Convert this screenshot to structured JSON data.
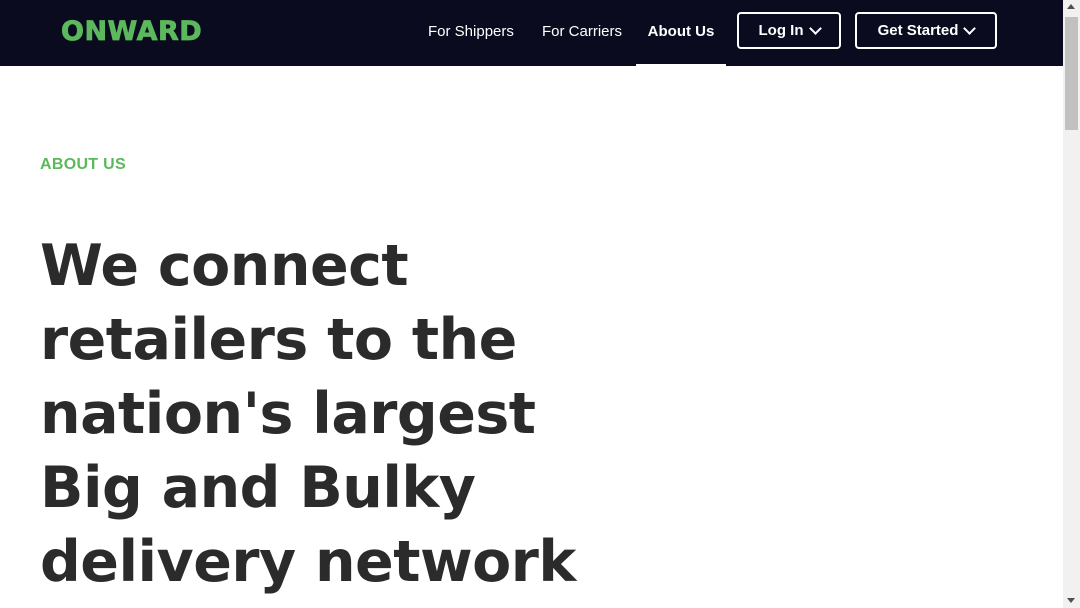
{
  "brand": {
    "logo_text": "ONWARD",
    "accent_color": "#5cb85c",
    "nav_bg": "#0a0b1e"
  },
  "nav": {
    "links": [
      {
        "label": "For Shippers"
      },
      {
        "label": "For Carriers"
      },
      {
        "label": "About Us",
        "active": true
      }
    ],
    "login_label": "Log In",
    "get_started_label": "Get Started",
    "chevron_icon": "chevron-down-icon"
  },
  "hero": {
    "eyebrow": "ABOUT US",
    "headline_lines": [
      "We connect",
      "retailers to the",
      "nation's largest",
      "Big and Bulky",
      "delivery network"
    ]
  }
}
